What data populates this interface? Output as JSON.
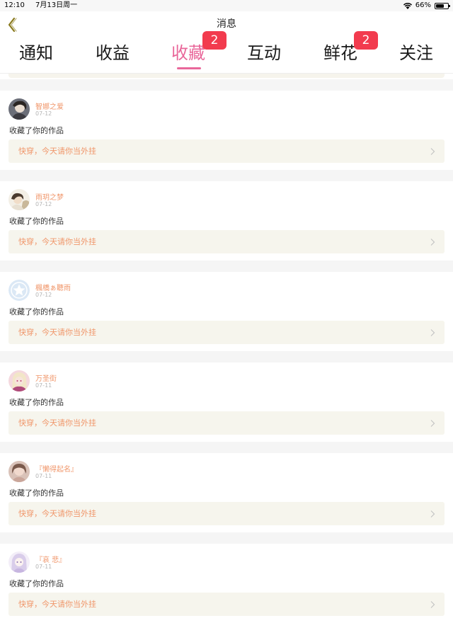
{
  "status": {
    "time": "12:10",
    "date": "7月13日周一",
    "battery": "66%",
    "battery_level": 0.66
  },
  "nav": {
    "title": "消息"
  },
  "tabs": [
    {
      "label": "通知"
    },
    {
      "label": "收益"
    },
    {
      "label": "收藏",
      "badge": "2"
    },
    {
      "label": "互动"
    },
    {
      "label": "鲜花",
      "badge": "2"
    },
    {
      "label": "关注"
    }
  ],
  "active_tab": "收藏",
  "items": [
    {
      "user": "智娜之爱",
      "date": "07-12",
      "action": "收藏了你的作品",
      "work": "快穿，今天请你当外挂"
    },
    {
      "user": "雨玥之梦",
      "date": "07-12",
      "action": "收藏了你的作品",
      "work": "快穿，今天请你当外挂"
    },
    {
      "user": "楓橋ぁ聽雨",
      "date": "07-12",
      "action": "收藏了你的作品",
      "work": "快穿，今天请你当外挂"
    },
    {
      "user": "万圣街",
      "date": "07-11",
      "action": "收藏了你的作品",
      "work": "快穿，今天请你当外挂"
    },
    {
      "user": "『懒得起名』",
      "date": "07-11",
      "action": "收藏了你的作品",
      "work": "快穿，今天请你当外挂"
    },
    {
      "user": "『哀 悲』",
      "date": "07-11",
      "action": "收藏了你的作品",
      "work": "快穿，今天请你当外挂"
    }
  ],
  "colors": {
    "accent": "#e9679a",
    "badge": "#f23b4e",
    "name": "#f0966a",
    "work_bg": "#f6f5ed"
  }
}
